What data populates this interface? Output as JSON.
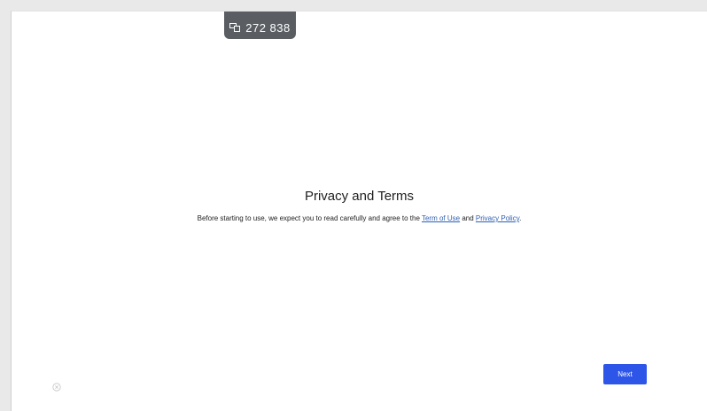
{
  "badge": {
    "text": "272 838",
    "icon": "device-icon"
  },
  "dialog": {
    "title": "Privacy and Terms",
    "description_prefix": "Before starting to use, we expect you to read carefully and agree to the ",
    "terms_link": "Term of Use",
    "conjunction": " and ",
    "privacy_link": "Privacy Policy",
    "suffix": "."
  },
  "actions": {
    "next_label": "Next"
  },
  "colors": {
    "accent": "#2d56e8",
    "link": "#2f5fb3",
    "badge_bg": "#5a5e63"
  }
}
